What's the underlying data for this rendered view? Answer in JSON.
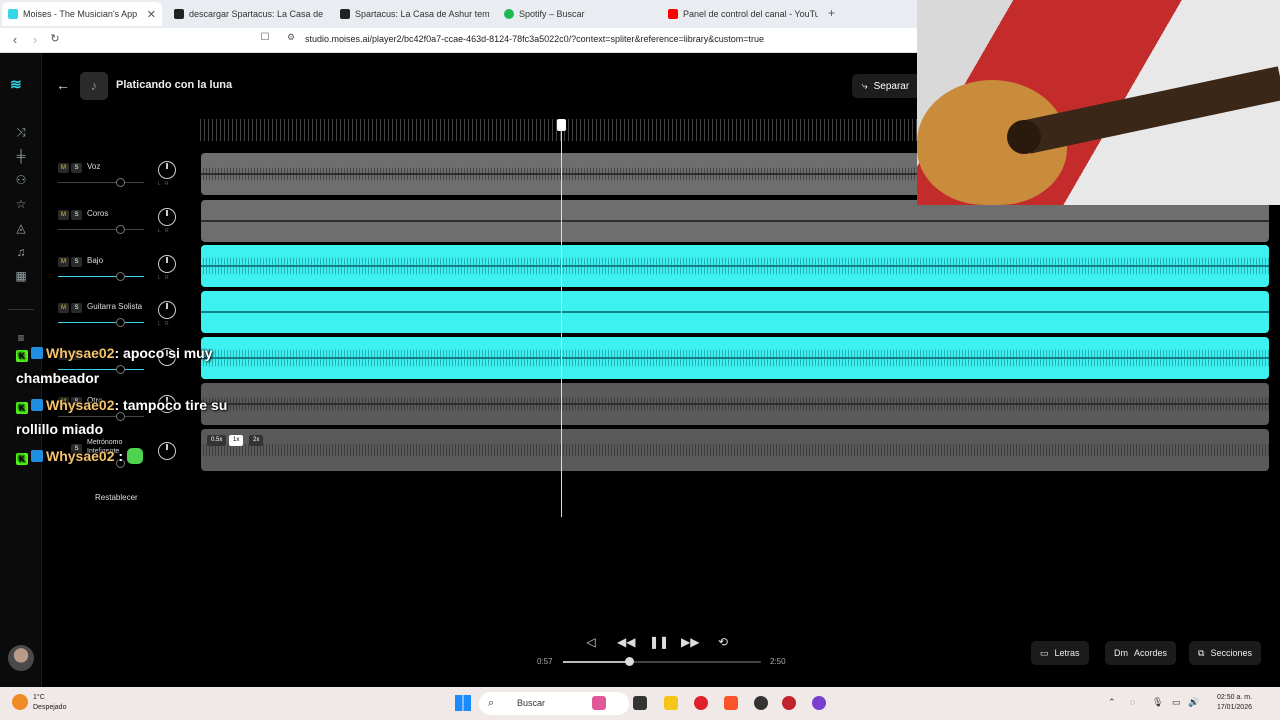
{
  "browser": {
    "tabs": [
      {
        "label": "Moises - The Musician's App",
        "active": true
      },
      {
        "label": "descargar Spartacus: La Casa de Ashur"
      },
      {
        "label": "Spartacus: La Casa de Ashur tempora"
      },
      {
        "label": "Spotify – Buscar"
      },
      {
        "label": "Panel de control del canal - YouTube"
      }
    ],
    "url": "studio.moises.ai/player2/bc42f0a7-ccae-463d-8124-78fc3a5022c0/?context=spliter&reference=library&custom=true"
  },
  "app": {
    "song_title": "Platicando con la luna",
    "separar_label": "Separar",
    "tracks": [
      {
        "name": "Voz"
      },
      {
        "name": "Coros"
      },
      {
        "name": "Bajo"
      },
      {
        "name": "Guitarra Solista"
      },
      {
        "name": ""
      },
      {
        "name": "Otro"
      },
      {
        "name": "Metrónomo Inteligente"
      }
    ],
    "mute_label": "M",
    "solo_label": "S",
    "speed_options": [
      "0.5x",
      "1x",
      "2x"
    ],
    "reset_label": "Restablecer",
    "player": {
      "current_time": "0:57",
      "total_time": "2:50",
      "progress": 0.335
    },
    "right_buttons": [
      {
        "label": "Letras"
      },
      {
        "label": "Acordes",
        "prefix": "Dm"
      },
      {
        "label": "Secciones"
      }
    ]
  },
  "chat": [
    {
      "user": "Whysae02",
      "text": ": apoco si muy",
      "cont": "chambeador"
    },
    {
      "user": "Whysae02",
      "text": ": tampoco tire su",
      "cont": "rollillo miado"
    },
    {
      "user": "Whysae02",
      "text": " :"
    }
  ],
  "taskbar": {
    "weather_temp": "1°C",
    "weather_desc": "Despejado",
    "search_placeholder": "Buscar",
    "time": "02:50 a. m.",
    "date": "17/01/2026"
  },
  "colors": {
    "accent": "#3ef1f1",
    "mute": "#f5c518",
    "chat_user": "#f3c26b"
  }
}
